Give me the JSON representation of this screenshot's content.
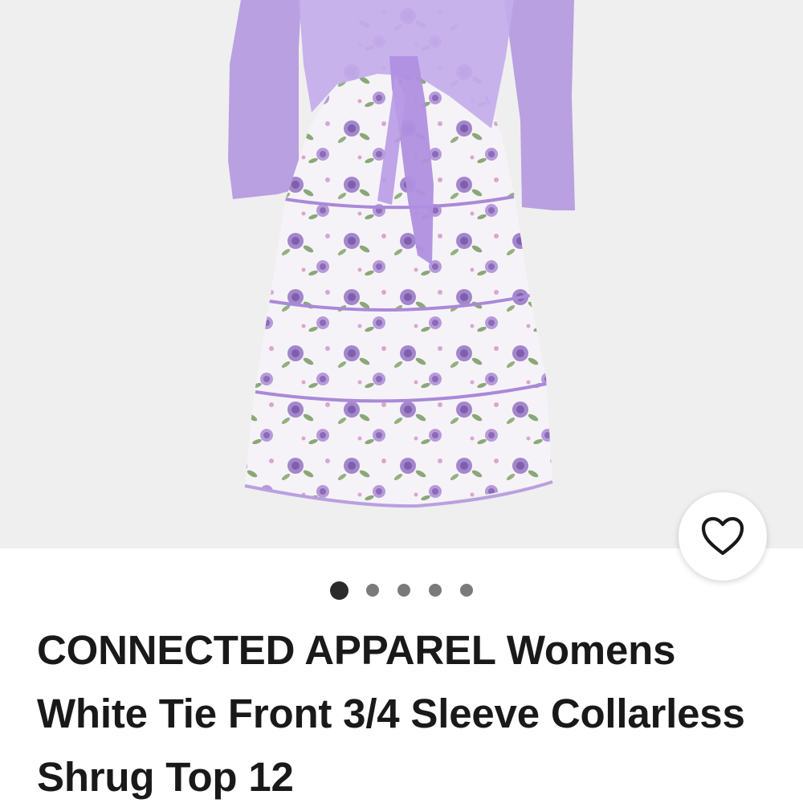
{
  "gallery": {
    "image_alt": "Lavender floral tiered dress with sheer tie-front shrug",
    "image_count": 5,
    "active_index": 0,
    "colors": {
      "background": "#efefef",
      "shrug": "#b9a0e0",
      "dress": "#f6f3f8",
      "flower": "#9b7cc6",
      "leaf": "#8aa877"
    }
  },
  "favorite": {
    "icon": "heart-outline-icon",
    "aria_label": "Add to watchlist"
  },
  "item": {
    "title": "CONNECTED APPAREL Womens White Tie Front 3/4 Sleeve Collarless Shrug Top 12"
  }
}
